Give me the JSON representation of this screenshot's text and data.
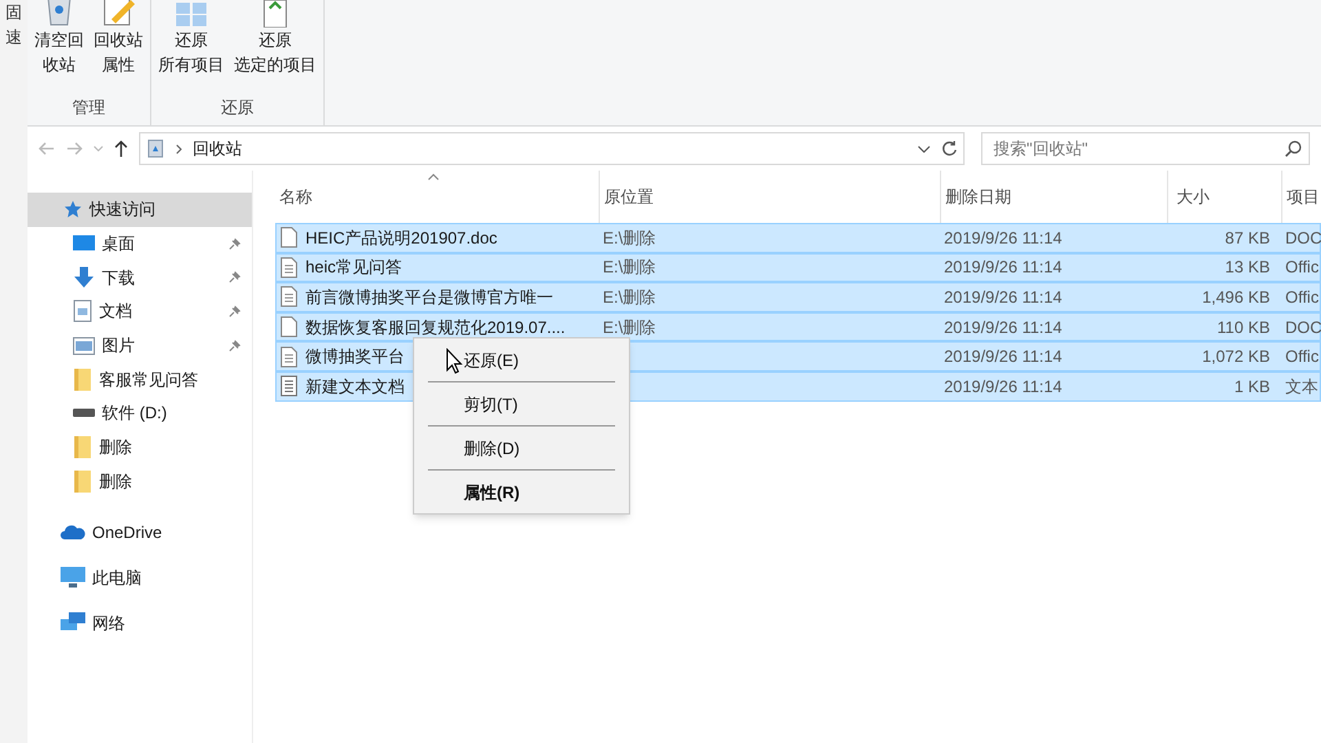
{
  "background_window": {
    "fragments": [
      "固",
      "速"
    ]
  },
  "ribbon": {
    "groups": [
      {
        "label": "管理",
        "buttons": [
          {
            "lines": [
              "清空回",
              "收站"
            ]
          },
          {
            "lines": [
              "回收站",
              "属性"
            ]
          }
        ]
      },
      {
        "label": "还原",
        "buttons": [
          {
            "lines": [
              "还原",
              "所有项目"
            ]
          },
          {
            "lines": [
              "还原",
              "选定的项目"
            ]
          }
        ]
      }
    ]
  },
  "address_bar": {
    "path": "回收站"
  },
  "search": {
    "placeholder": "搜索\"回收站\""
  },
  "sidebar": {
    "items": [
      {
        "label": "快速访问",
        "selected": true,
        "pinned": false
      },
      {
        "label": "桌面",
        "selected": false,
        "pinned": true
      },
      {
        "label": "下载",
        "selected": false,
        "pinned": true
      },
      {
        "label": "文档",
        "selected": false,
        "pinned": true
      },
      {
        "label": "图片",
        "selected": false,
        "pinned": true
      },
      {
        "label": "客服常见问答",
        "selected": false,
        "pinned": false
      },
      {
        "label": "软件 (D:)",
        "selected": false,
        "pinned": false
      },
      {
        "label": "删除",
        "selected": false,
        "pinned": false
      },
      {
        "label": "删除",
        "selected": false,
        "pinned": false
      },
      {
        "label": "OneDrive",
        "selected": false,
        "pinned": false
      },
      {
        "label": "此电脑",
        "selected": false,
        "pinned": false
      },
      {
        "label": "网络",
        "selected": false,
        "pinned": false
      }
    ]
  },
  "table": {
    "columns": [
      "名称",
      "原位置",
      "删除日期",
      "大小",
      "项目"
    ],
    "rows": [
      {
        "name": "HEIC产品说明201907.doc",
        "location": "E:\\删除",
        "date": "2019/9/26 11:14",
        "size": "87 KB",
        "type": "DOC",
        "selected": true
      },
      {
        "name": "heic常见问答",
        "location": "E:\\删除",
        "date": "2019/9/26 11:14",
        "size": "13 KB",
        "type": "Offic",
        "selected": true
      },
      {
        "name": "前言微博抽奖平台是微博官方唯一",
        "location": "E:\\删除",
        "date": "2019/9/26 11:14",
        "size": "1,496 KB",
        "type": "Offic",
        "selected": true
      },
      {
        "name": "数据恢复客服回复规范化2019.07....",
        "location": "E:\\删除",
        "date": "2019/9/26 11:14",
        "size": "110 KB",
        "type": "DOC",
        "selected": true
      },
      {
        "name": "微博抽奖平台",
        "date": "2019/9/26 11:14",
        "size": "1,072 KB",
        "type": "Offic",
        "selected": true
      },
      {
        "name": "新建文本文档",
        "date": "2019/9/26 11:14",
        "size": "1 KB",
        "type": "文本",
        "selected": true
      }
    ]
  },
  "context_menu": {
    "items": [
      {
        "label": "还原(E)",
        "bold": false
      },
      {
        "label": "剪切(T)",
        "bold": false
      },
      {
        "label": "删除(D)",
        "bold": false
      },
      {
        "label": "属性(R)",
        "bold": true
      }
    ]
  }
}
